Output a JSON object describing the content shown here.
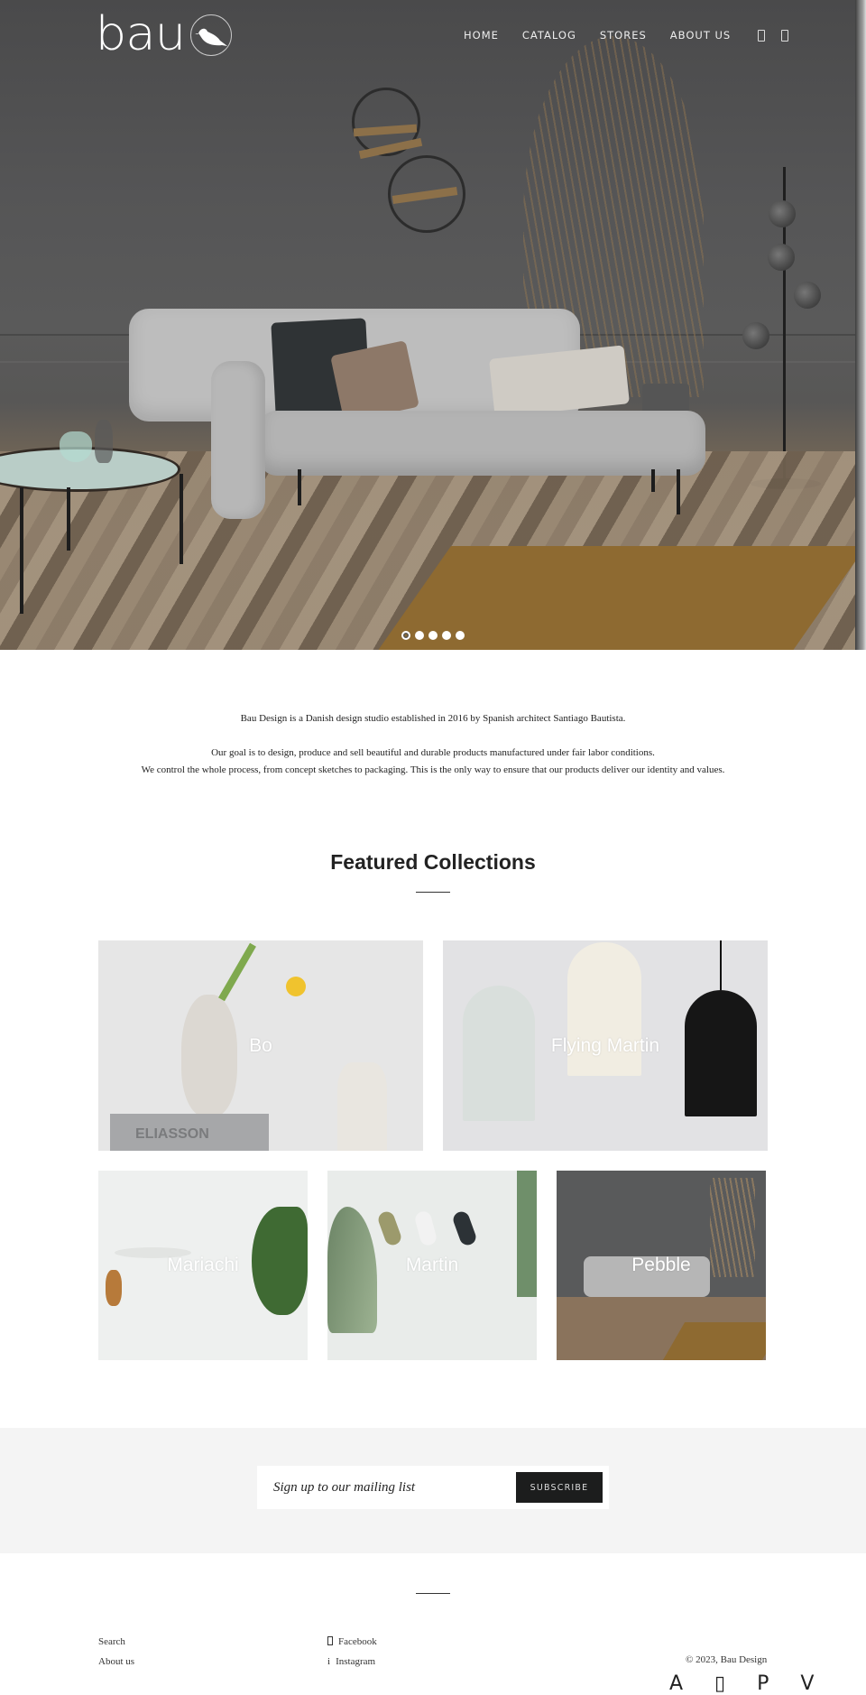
{
  "header": {
    "logo_text": "bau",
    "logo_icon": "bird-in-circle-icon",
    "nav": [
      {
        "label": "HOME"
      },
      {
        "label": "CATALOG"
      },
      {
        "label": "STORES"
      },
      {
        "label": "ABOUT US"
      }
    ],
    "icons": [
      "account-icon",
      "cart-icon"
    ]
  },
  "hero": {
    "slide_count": 5,
    "active_slide": 1
  },
  "intro": {
    "line1": "Bau Design is a Danish design studio established in 2016 by Spanish architect Santiago Bautista.",
    "line2": "Our goal is to design, produce and sell beautiful and durable products manufactured under fair labor conditions.",
    "line3": "We control the whole process, from concept sketches to packaging. This is the only way to ensure that our products deliver our identity and values."
  },
  "featured": {
    "title": "Featured Collections",
    "collections": [
      {
        "label": "Bo"
      },
      {
        "label": "Flying Martin"
      },
      {
        "label": "Mariachi"
      },
      {
        "label": "Martin"
      },
      {
        "label": "Pebble"
      }
    ]
  },
  "newsletter": {
    "placeholder": "Sign up to our mailing list",
    "value": "",
    "button_label": "SUBSCRIBE"
  },
  "footer": {
    "links": [
      {
        "label": "Search"
      },
      {
        "label": "About us"
      }
    ],
    "social": [
      {
        "label": "Facebook",
        "icon": "facebook-icon"
      },
      {
        "label": "Instagram",
        "icon": "instagram-icon"
      }
    ],
    "copyright": "© 2023, Bau Design",
    "payment_icons": "A ▯ P V"
  }
}
